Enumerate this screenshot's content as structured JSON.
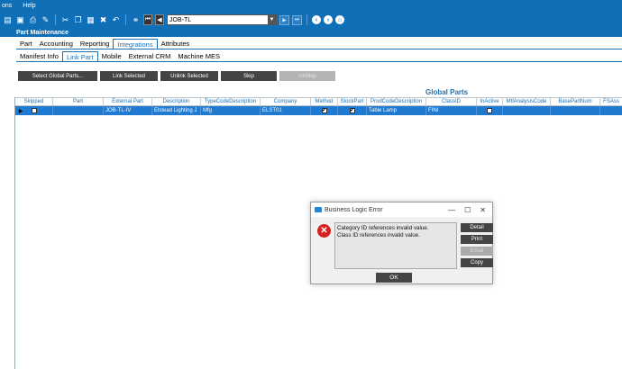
{
  "menubar": {
    "items": [
      "ons",
      "Help"
    ]
  },
  "toolbar": {
    "key_value": "JOB-TL",
    "nav_buttons": [
      "⏮",
      "◀",
      "▶",
      "⏭"
    ]
  },
  "window": {
    "title": "Part Maintenance"
  },
  "tabs_primary": [
    "Part",
    "Accounting",
    "Reporting",
    "Integrations",
    "Attributes"
  ],
  "tabs_primary_active": "Integrations",
  "tabs_secondary": [
    "Manifest Info",
    "Link Part",
    "Mobile",
    "External CRM",
    "Machine MES"
  ],
  "tabs_secondary_active": "Link Part",
  "actions": {
    "select_global": "Select Global Parts...",
    "link_selected": "Link Selected",
    "unlink_selected": "Unlink Selected",
    "skip": "Skip",
    "unskip": "UnSkip"
  },
  "grid": {
    "title": "Global Parts",
    "columns": [
      "Skipped",
      "Part",
      "External Part",
      "Description",
      "TypeCodeDescription",
      "Company",
      "Method",
      "StockPart",
      "ProdCodeDescription",
      "ClassID",
      "InActive",
      "MtlAnalysisCode",
      "BasePartNum",
      "FSAss"
    ],
    "rows": [
      {
        "skipped": false,
        "part": "",
        "external_part": "JOB-TL-IV",
        "description": "Elstead Lighting J",
        "type_code": "Mfg",
        "company": "ELST01",
        "method": true,
        "stock_part": true,
        "prod_code": "Table Lamp",
        "class_id": "FINI",
        "inactive": false,
        "mtl_analysis": "",
        "base_part": "",
        "fsass": ""
      }
    ]
  },
  "dialog": {
    "title": "Business Logic Error",
    "message_line1": "Category ID references invalid value.",
    "message_line2": "Class ID references invalid value.",
    "buttons": {
      "detail": "Detail",
      "print": "Print",
      "email": "Email",
      "copy": "Copy",
      "ok": "OK"
    }
  }
}
